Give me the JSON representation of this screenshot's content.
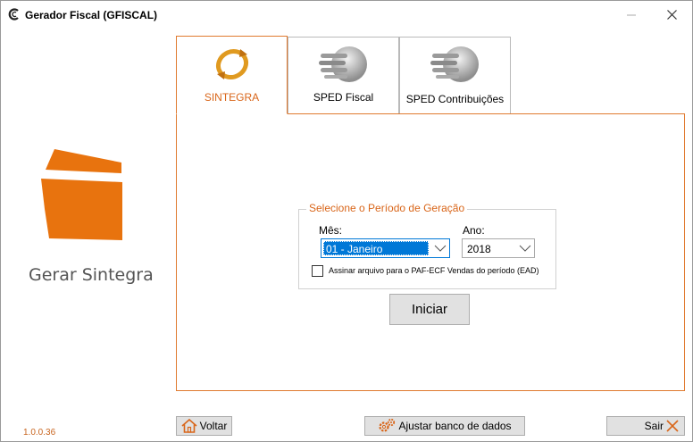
{
  "window": {
    "title": "Gerador Fiscal (GFISCAL)"
  },
  "left_panel": {
    "heading": "Gerar Sintegra",
    "version": "1.0.0.36"
  },
  "tabs": [
    {
      "label": "SINTEGRA",
      "active": true
    },
    {
      "label": "SPED Fiscal",
      "active": false
    },
    {
      "label": "SPED Contribuições",
      "active": false
    }
  ],
  "period": {
    "legend": "Selecione o Período de Geração",
    "month_label": "Mês:",
    "month_value": "01 - Janeiro",
    "year_label": "Ano:",
    "year_value": "2018",
    "checkbox_label": "Assinar arquivo para o PAF-ECF Vendas do período (EAD)",
    "checkbox_checked": false
  },
  "buttons": {
    "start": "Iniciar",
    "back": "Voltar",
    "adjust_db": "Ajustar banco de dados",
    "exit": "Sair"
  },
  "colors": {
    "accent": "#E07A2F",
    "logo": "#E8730E",
    "selection": "#0078D7"
  }
}
